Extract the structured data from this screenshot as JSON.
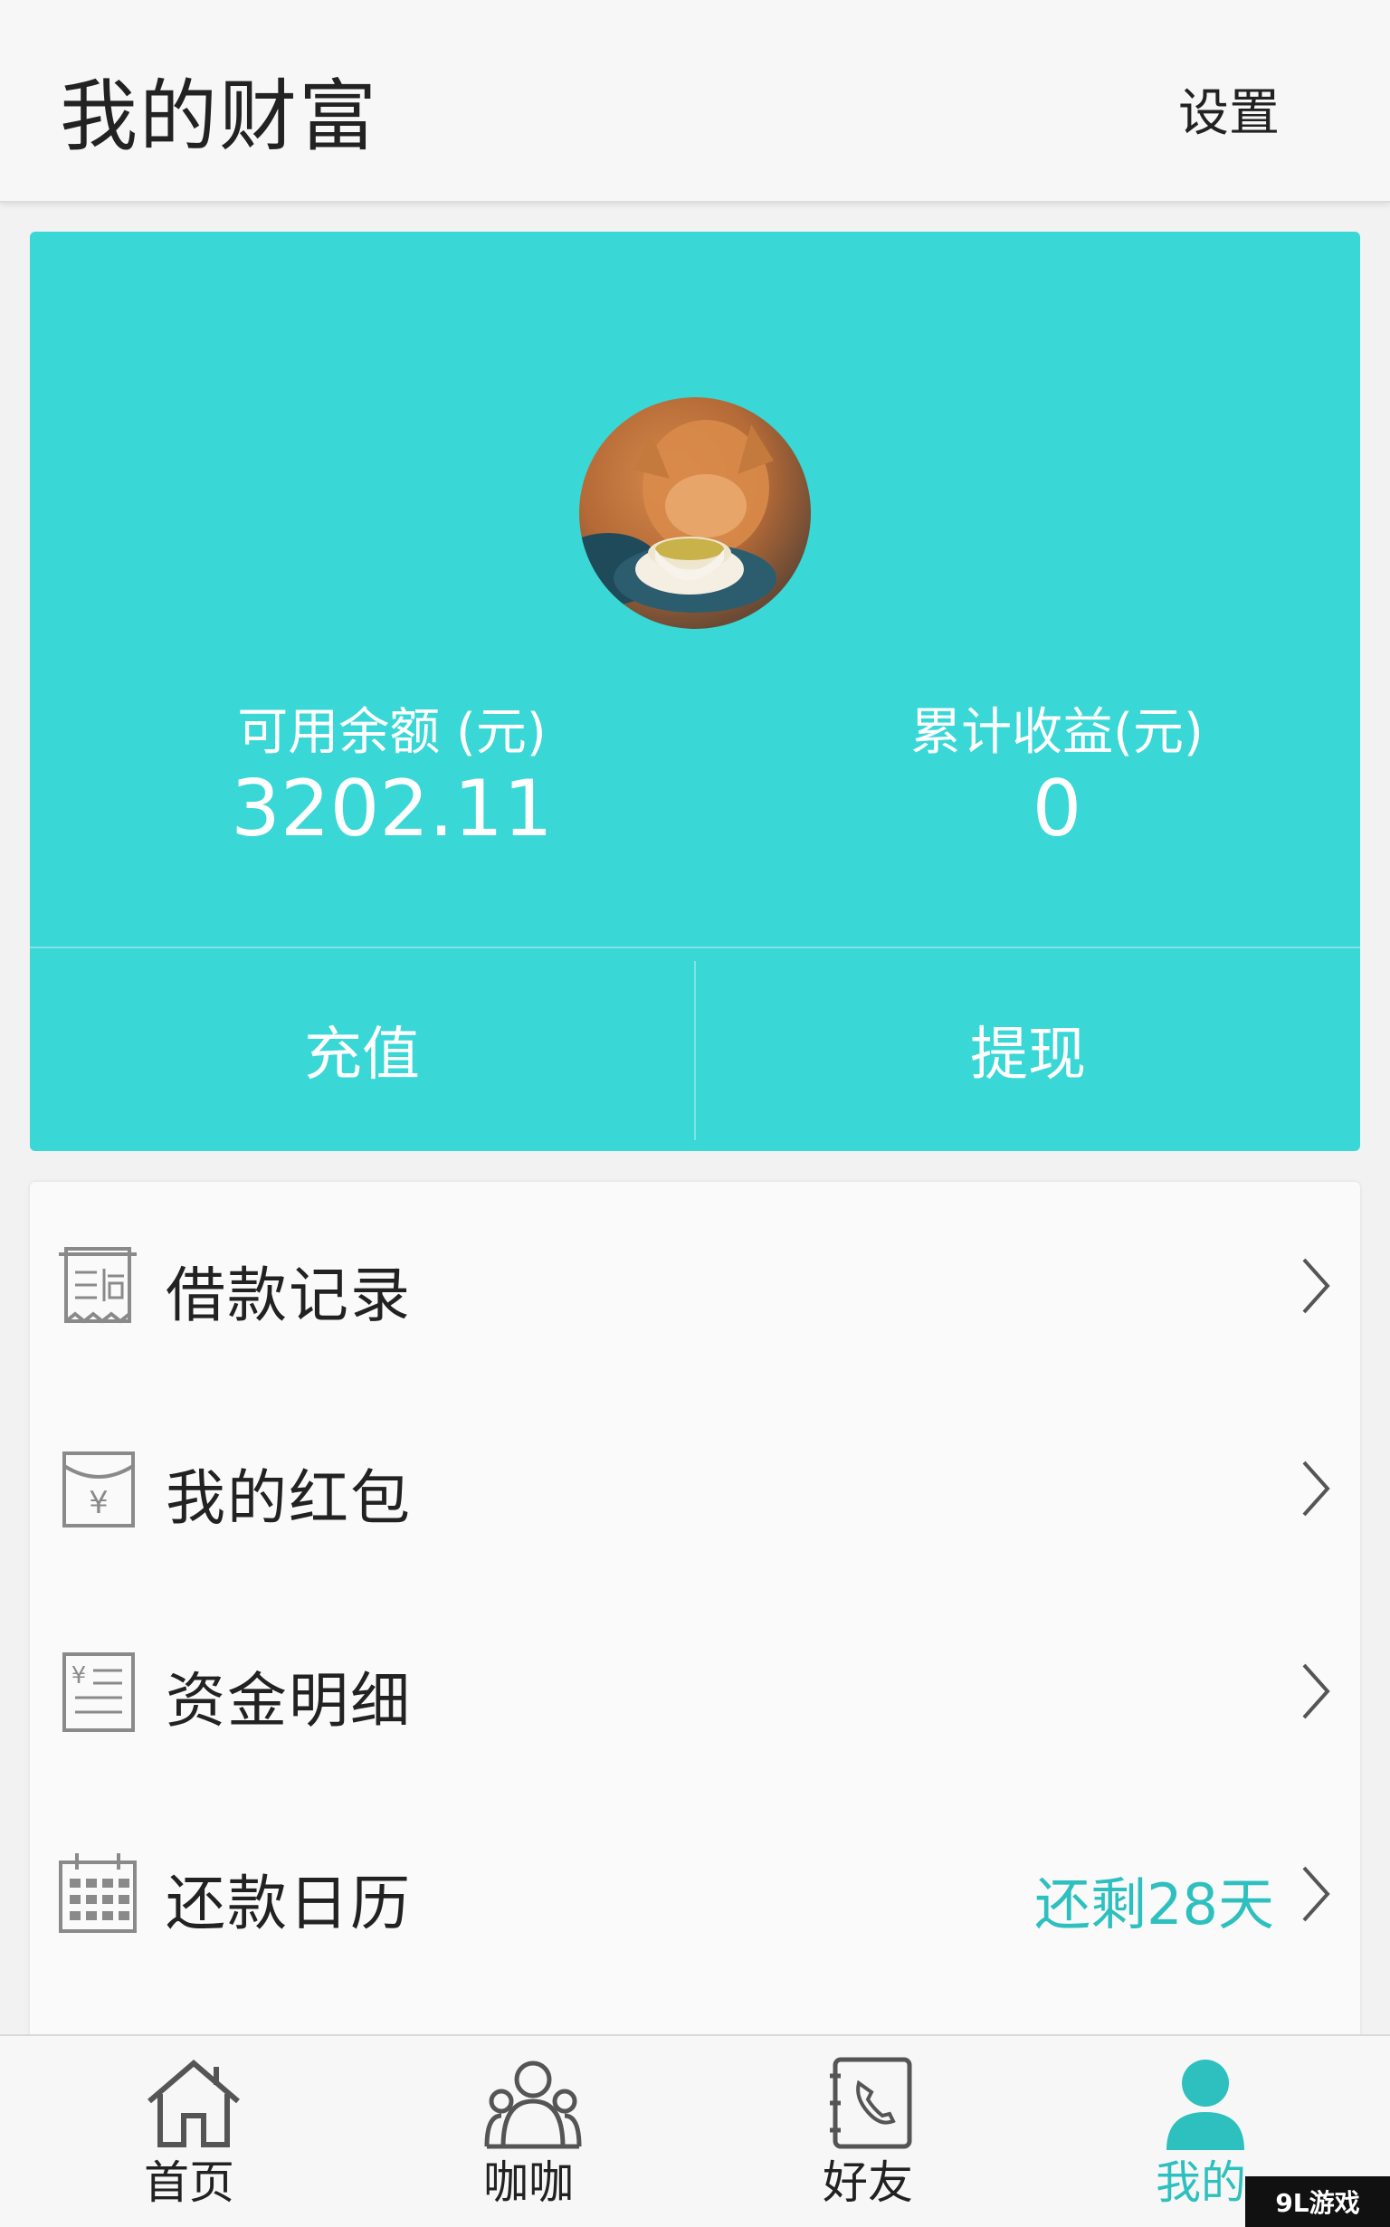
{
  "header": {
    "title": "我的财富",
    "settings_label": "设置"
  },
  "wallet": {
    "balance_label": "可用余额 (元)",
    "balance_value": "3202.11",
    "earnings_label": "累计收益(元)",
    "earnings_value": "0",
    "recharge_label": "充值",
    "withdraw_label": "提现"
  },
  "menu": {
    "items": [
      {
        "label": "借款记录",
        "icon": "loan-record-icon",
        "extra": ""
      },
      {
        "label": "我的红包",
        "icon": "red-envelope-icon",
        "extra": ""
      },
      {
        "label": "资金明细",
        "icon": "fund-details-icon",
        "extra": ""
      },
      {
        "label": "还款日历",
        "icon": "calendar-icon",
        "extra": "还剩28天"
      }
    ]
  },
  "tabbar": {
    "items": [
      {
        "label": "首页",
        "icon": "home-icon"
      },
      {
        "label": "咖咖",
        "icon": "group-icon"
      },
      {
        "label": "好友",
        "icon": "contacts-icon"
      },
      {
        "label": "我的",
        "icon": "profile-icon",
        "active": true
      }
    ]
  },
  "watermark": "9L游戏",
  "colors": {
    "accent": "#39d7d6",
    "accent_text": "#2ec0bf"
  }
}
